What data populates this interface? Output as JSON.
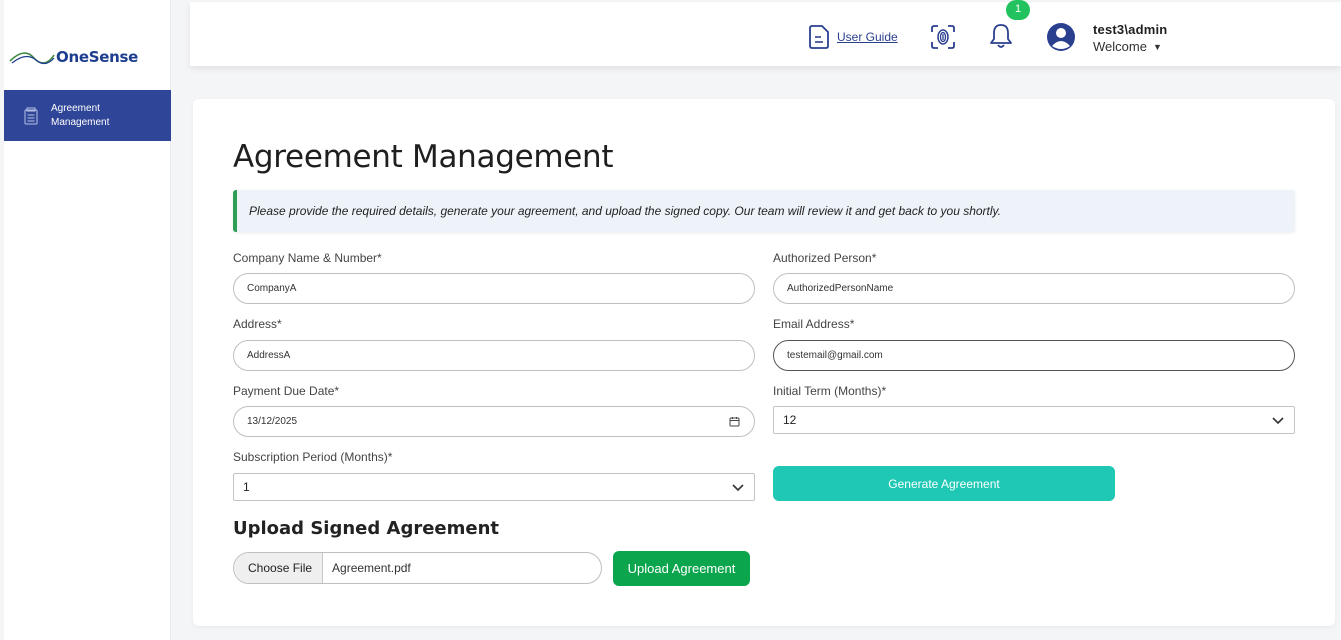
{
  "brand": {
    "logo_text": "OneSense"
  },
  "sidebar": {
    "items": [
      {
        "label": "Agreement Management",
        "icon": "document-stack-icon"
      }
    ]
  },
  "header": {
    "user_guide_label": "User Guide",
    "notification_count": "1",
    "username": "test3\\admin",
    "welcome": "Welcome"
  },
  "page": {
    "title": "Agreement Management",
    "notice": "Please provide the required details, generate your agreement, and upload the signed copy. Our team will review it and get back to you shortly."
  },
  "form": {
    "company": {
      "label": "Company Name & Number*",
      "value": "CompanyA"
    },
    "authorized": {
      "label": "Authorized Person*",
      "value": "AuthorizedPersonName"
    },
    "address": {
      "label": "Address*",
      "value": "AddressA"
    },
    "email": {
      "label": "Email Address*",
      "value": "testemail@gmail.com"
    },
    "payment_due": {
      "label": "Payment Due Date*",
      "value": "13/12/2025"
    },
    "initial_term": {
      "label": "Initial Term (Months)*",
      "value": "12"
    },
    "subscription": {
      "label": "Subscription Period (Months)*",
      "value": "1"
    },
    "generate_label": "Generate Agreement"
  },
  "upload": {
    "title": "Upload Signed Agreement",
    "choose_file_label": "Choose File",
    "file_name": "Agreement.pdf",
    "upload_label": "Upload Agreement"
  },
  "colors": {
    "sidebar_active": "#2f4597",
    "generate_button": "#1ec8b4",
    "upload_button": "#0ba54d",
    "badge": "#22c35e",
    "notice_border": "#2e9e55"
  }
}
